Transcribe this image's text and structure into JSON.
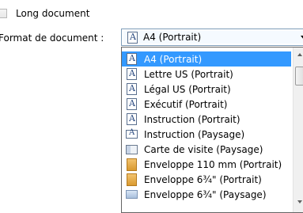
{
  "checkbox": {
    "label": "Long document",
    "checked": false
  },
  "format": {
    "label": "Format de document :",
    "selected": "A4 (Portrait)",
    "selected_icon": "page-portrait-icon"
  },
  "dropdown": {
    "items": [
      {
        "label": "A4 (Portrait)",
        "icon": "page-portrait-icon",
        "selected": true
      },
      {
        "label": "Lettre US (Portrait)",
        "icon": "page-portrait-icon",
        "selected": false
      },
      {
        "label": "Légal US (Portrait)",
        "icon": "page-portrait-icon",
        "selected": false
      },
      {
        "label": "Exécutif (Portrait)",
        "icon": "page-portrait-icon",
        "selected": false
      },
      {
        "label": "Instruction (Portrait)",
        "icon": "page-portrait-icon",
        "selected": false
      },
      {
        "label": "Instruction (Paysage)",
        "icon": "page-landscape-icon",
        "selected": false
      },
      {
        "label": "Carte de visite (Paysage)",
        "icon": "business-card-icon",
        "selected": false
      },
      {
        "label": "Enveloppe 110 mm (Portrait)",
        "icon": "envelope-portrait-icon",
        "selected": false
      },
      {
        "label": "Enveloppe 6¾\" (Portrait)",
        "icon": "envelope-portrait-icon",
        "selected": false
      },
      {
        "label": "Enveloppe 6¾\" (Paysage)",
        "icon": "envelope-landscape-icon",
        "selected": false
      }
    ]
  },
  "colors": {
    "selection": "#3399ff",
    "combo_border": "#7f9db9"
  }
}
